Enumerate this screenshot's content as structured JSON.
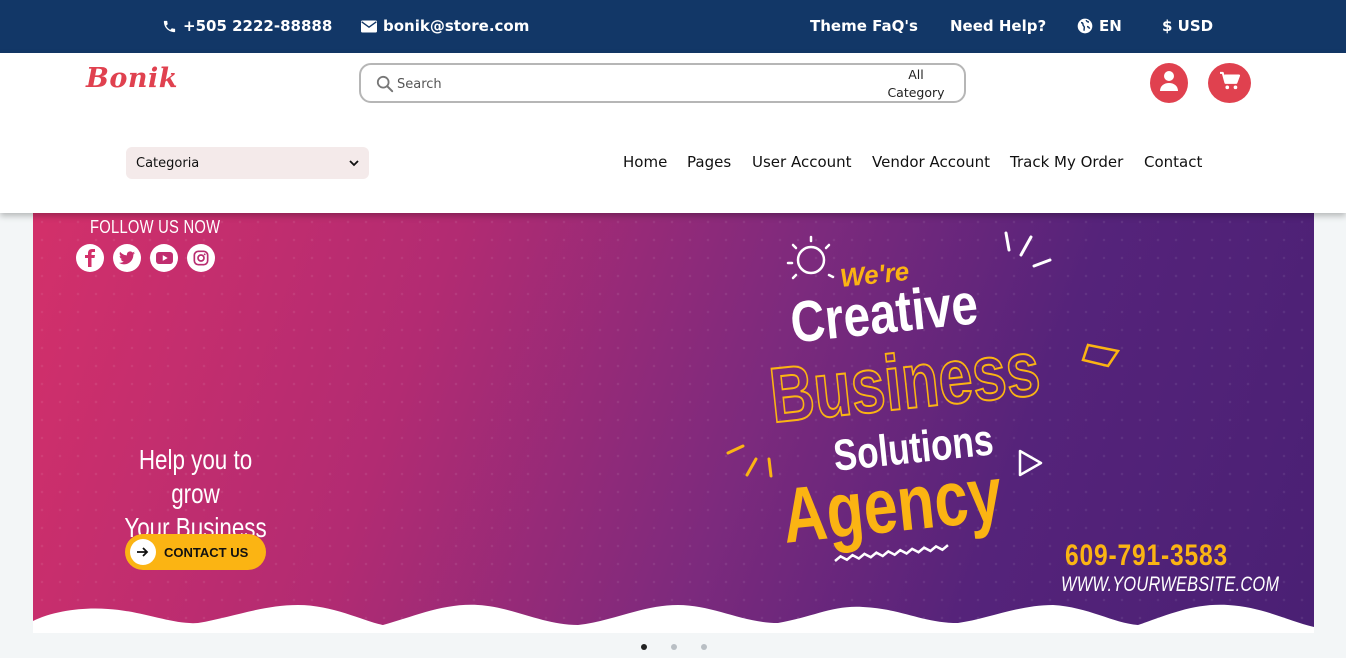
{
  "topbar": {
    "phone": "+505 2222-88888",
    "email": "bonik@store.com",
    "faq": "Theme FaQ's",
    "help": "Need Help?",
    "language": "EN",
    "currency": "$ USD"
  },
  "header": {
    "logo": "Bonik",
    "search_placeholder": "Search",
    "all_category_line1": "All",
    "all_category_line2": "Category",
    "category_select": "Categoria",
    "nav": [
      "Home",
      "Pages",
      "User Account",
      "Vendor Account",
      "Track My Order",
      "Contact"
    ]
  },
  "banner": {
    "follow": "FOLLOW US NOW",
    "social": [
      "facebook-icon",
      "twitter-icon",
      "youtube-icon",
      "instagram-icon"
    ],
    "help_line1": "Help you to grow",
    "help_line2": "Your Business",
    "cta": "CONTACT US",
    "headline": {
      "were": "We're",
      "creative": "Creative",
      "business": "Business",
      "solutions": "Solutions",
      "agency": "Agency"
    },
    "phone": "609-791-3583",
    "website": "WWW.YOURWEBSITE.COM"
  },
  "slider": {
    "count": 3,
    "active": 1
  },
  "colors": {
    "topbar": "#123767",
    "accent": "#e0414f",
    "yellow": "#fbb413"
  }
}
